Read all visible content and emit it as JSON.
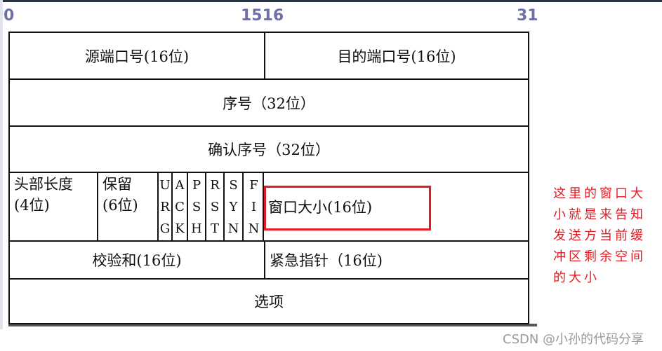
{
  "bit_labels": [
    "0",
    "1516",
    "31"
  ],
  "rows": {
    "src_port": "源端口号(16位)",
    "dst_port": "目的端口号(16位)",
    "seq": "序号（32位）",
    "ack": "确认序号（32位）",
    "header_len": [
      "头部长度",
      "(4位)"
    ],
    "reserved": [
      "保留",
      "(6位)"
    ],
    "flags": [
      [
        "U",
        "R",
        "G"
      ],
      [
        "A",
        "C",
        "K"
      ],
      [
        "P",
        "S",
        "H"
      ],
      [
        "R",
        "S",
        "T"
      ],
      [
        "S",
        "Y",
        "N"
      ],
      [
        "F",
        "I",
        "N"
      ]
    ],
    "window": "窗口大小(16位)",
    "checksum": "校验和(16位)",
    "urgent": "紧急指针（16位)",
    "options": "选项"
  },
  "annotation": "这里的窗口大小就是来告知发送方当前缓冲区剩余空间的大小",
  "watermark": "CSDN @小孙的代码分享",
  "colors": {
    "annotation": "#e01b24",
    "bit_labels": "#6f70a6"
  }
}
